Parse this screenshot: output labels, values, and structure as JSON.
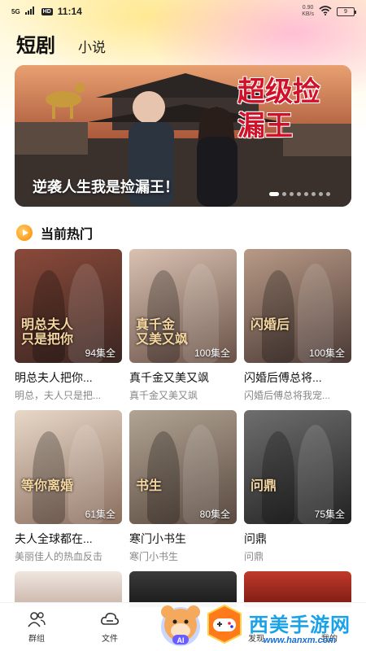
{
  "status_bar": {
    "left_tag": "5G",
    "hd_tag": "HD",
    "time": "11:14",
    "speed_value": "0.90",
    "speed_unit": "KB/s",
    "battery": "9"
  },
  "header": {
    "tabs": [
      {
        "label": "短剧",
        "active": true
      },
      {
        "label": "小说",
        "active": false
      }
    ]
  },
  "banner": {
    "title": "逆袭人生我是捡漏王！",
    "art_title": "超级捡漏王",
    "dot_count": 8,
    "active_dot": 0
  },
  "section": {
    "title": "当前热门"
  },
  "dramas": [
    {
      "title": "明总夫人把你...",
      "subtitle": "明总，夫人只是把...",
      "episodes": "94集全",
      "cover_text": "明总夫人\n只是把你",
      "colors": [
        "#8a4a3a",
        "#3a2622"
      ]
    },
    {
      "title": "真千金又美又飒",
      "subtitle": "真千金又美又飒",
      "episodes": "100集全",
      "cover_text": "真千金\n又美又飒",
      "colors": [
        "#d9c2b2",
        "#6a5248"
      ]
    },
    {
      "title": "闪婚后傅总将...",
      "subtitle": "闪婚后傅总将我宠...",
      "episodes": "100集全",
      "cover_text": "闪婚后",
      "colors": [
        "#b89a86",
        "#4b3a36"
      ]
    },
    {
      "title": "夫人全球都在...",
      "subtitle": "美丽佳人的热血反击",
      "episodes": "61集全",
      "cover_text": "等你离婚",
      "colors": [
        "#e8d8c8",
        "#8a6e5e"
      ]
    },
    {
      "title": "寒门小书生",
      "subtitle": "寒门小书生",
      "episodes": "80集全",
      "cover_text": "书生",
      "colors": [
        "#b2a494",
        "#5a4a40"
      ]
    },
    {
      "title": "问鼎",
      "subtitle": "问鼎",
      "episodes": "75集全",
      "cover_text": "问鼎",
      "colors": [
        "#6e6e6e",
        "#222222"
      ]
    }
  ],
  "next_row": [
    {
      "colors": [
        "#f0e6e0",
        "#c9b4a8"
      ]
    },
    {
      "colors": [
        "#3a3a3a",
        "#1a1a1a"
      ]
    },
    {
      "colors": [
        "#c03a2a",
        "#7a1a14"
      ]
    }
  ],
  "bottom_nav": [
    {
      "label": "群组",
      "icon": "group-icon"
    },
    {
      "label": "文件",
      "icon": "cloud-icon"
    },
    {
      "label": "",
      "icon": "ai-bear-icon"
    },
    {
      "label": "发现",
      "icon": "game-icon"
    },
    {
      "label": "我的",
      "icon": "profile-icon"
    }
  ],
  "watermark": {
    "main": "西美手游网",
    "url": "www.hanxm.com",
    "badge_text": "AI"
  }
}
